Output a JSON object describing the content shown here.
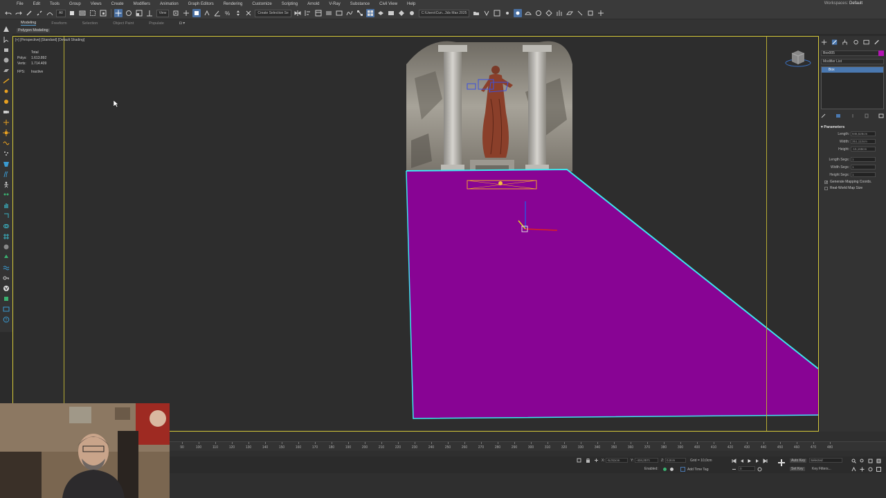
{
  "menubar": {
    "items": [
      "File",
      "Edit",
      "Tools",
      "Group",
      "Views",
      "Create",
      "Modifiers",
      "Animation",
      "Graph Editors",
      "Rendering",
      "Customize",
      "Scripting",
      "Arnold",
      "V-Ray",
      "Substance",
      "Civil View",
      "Help"
    ],
    "workspace_label": "Workspaces:",
    "workspace_value": "Default"
  },
  "toolbar": {
    "selection_filter": "All",
    "view_dropdown": "View",
    "selection_set": "Create Selection Se",
    "path": "C:\\Users\\Cun...3ds Max 2025"
  },
  "ribbon": {
    "tabs": [
      "Modeling",
      "Freeform",
      "Selection",
      "Object Paint",
      "Populate"
    ],
    "active_tab": "Modeling",
    "subpanel": "Polygon Modeling"
  },
  "viewport": {
    "label": "[+] [Perspective] [Standard] [Default Shading]",
    "stats": {
      "total_label": "Total",
      "polys_label": "Polys:",
      "polys_value": "1.613.892",
      "verts_label": "Verts:",
      "verts_value": "1.714.409",
      "fps_label": "FPS:",
      "fps_value": "Inactive"
    },
    "plane_color": "#880494",
    "selection_color": "#3ee6f0"
  },
  "command_panel": {
    "object_name": "Box005",
    "object_color": "#b414b4",
    "modifier_list": "Modifier List",
    "stack_selected": "Box",
    "rollout": "Parameters",
    "params": [
      {
        "label": "Length:",
        "value": "946,525cm"
      },
      {
        "label": "Width:",
        "value": "351,113cm"
      },
      {
        "label": "Height:",
        "value": "-15,168cm"
      },
      {
        "label": "Length Segs:",
        "value": "1"
      },
      {
        "label": "Width Segs:",
        "value": "1"
      },
      {
        "label": "Height Segs:",
        "value": "1"
      }
    ],
    "generate_mapping": "Generate Mapping Coords.",
    "real_world": "Real-World Map Size"
  },
  "timeline": {
    "ticks": [
      "90",
      "100",
      "110",
      "120",
      "130",
      "140",
      "150",
      "160",
      "170",
      "180",
      "190",
      "200",
      "210",
      "220",
      "230",
      "240",
      "250",
      "260",
      "270",
      "280",
      "290",
      "300",
      "310",
      "320",
      "330",
      "340",
      "350",
      "360",
      "370",
      "380",
      "390",
      "400",
      "410",
      "420",
      "430",
      "440",
      "450",
      "460",
      "470",
      "480"
    ]
  },
  "statusbar": {
    "x_label": "X:",
    "x_value": "-5,011cm",
    "y_label": "Y:",
    "y_value": "-434,257c",
    "z_label": "Z:",
    "z_value": "0,0cm",
    "grid": "Grid = 10,0cm",
    "enabled": "Enabled:",
    "add_time_tag": "Add Time Tag",
    "auto_key": "Auto Key",
    "selected": "Selected",
    "set_key": "Set Key",
    "key_filters": "Key Filters...",
    "frame": "0"
  }
}
